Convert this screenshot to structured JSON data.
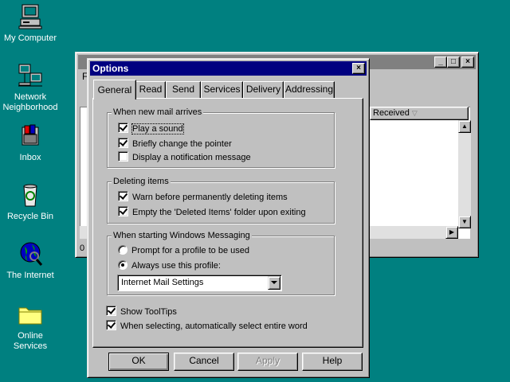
{
  "desktop": {
    "icons": [
      {
        "label": "My Computer"
      },
      {
        "label": "Network Neighborhood"
      },
      {
        "label": "Inbox"
      },
      {
        "label": "Recycle Bin"
      },
      {
        "label": "The Internet"
      },
      {
        "label": "Online Services"
      }
    ]
  },
  "background_window": {
    "menu_partial": "F",
    "column_received": "Received",
    "status_partial": "0"
  },
  "dialog": {
    "title": "Options",
    "close_glyph": "×",
    "tabs": [
      {
        "label": "General"
      },
      {
        "label": "Read"
      },
      {
        "label": "Send"
      },
      {
        "label": "Services"
      },
      {
        "label": "Delivery"
      },
      {
        "label": "Addressing"
      }
    ],
    "group_new_mail": {
      "label": "When new mail arrives",
      "play_sound": "Play a sound",
      "change_pointer": "Briefly change the pointer",
      "notification": "Display a notification message"
    },
    "group_deleting": {
      "label": "Deleting items",
      "warn": "Warn before permanently deleting items",
      "empty": "Empty the 'Deleted Items' folder upon exiting"
    },
    "group_starting": {
      "label": "When starting Windows Messaging",
      "prompt": "Prompt for a profile to be used",
      "always": "Always use this profile:",
      "profile_value": "Internet Mail Settings"
    },
    "show_tooltips": "Show ToolTips",
    "select_word": "When selecting, automatically select entire word",
    "buttons": {
      "ok": "OK",
      "cancel": "Cancel",
      "apply": "Apply",
      "help": "Help"
    }
  },
  "colors": {
    "desktop": "#008080",
    "active_title": "#000080",
    "inactive_title": "#808080",
    "face": "#c0c0c0"
  }
}
